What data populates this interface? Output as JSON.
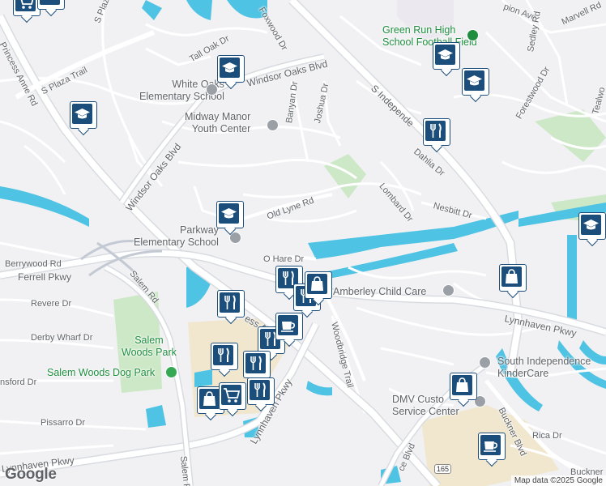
{
  "map": {
    "colors": {
      "land": "#f1f1f4",
      "road": "#ffffff",
      "road_outline": "#d8dbe0",
      "highway": "#aab4c3",
      "water": "#4fc3e3",
      "park": "#cde8c7",
      "commercial": "#f1e7cf",
      "marker": "#1b4e7a"
    },
    "streets": [
      {
        "id": "princess-anne-rd",
        "label": "Princess Anne Rd"
      },
      {
        "id": "s-plaza-trail",
        "label": "S Plaza Trail"
      },
      {
        "id": "s-plaza-top",
        "label": "S Plaza"
      },
      {
        "id": "tall-oak-dr",
        "label": "Tall Oak Dr"
      },
      {
        "id": "foxwood-dr",
        "label": "Foxwood Dr"
      },
      {
        "id": "windsor-oaks-blvd-north",
        "label": "Windsor Oaks Blvd"
      },
      {
        "id": "windsor-oaks-blvd-west",
        "label": "Windsor Oaks Blvd"
      },
      {
        "id": "banyan-dr",
        "label": "Banyan Dr"
      },
      {
        "id": "joshua-dr",
        "label": "Joshua Dr"
      },
      {
        "id": "s-independence",
        "label": "S Independe"
      },
      {
        "id": "dahlia-dr",
        "label": "Dahlia Dr"
      },
      {
        "id": "lombard-dr",
        "label": "Lombard Dr"
      },
      {
        "id": "nesbitt-dr",
        "label": "Nesbitt Dr"
      },
      {
        "id": "old-lyne-rd",
        "label": "Old Lyne Rd"
      },
      {
        "id": "ohare-dr",
        "label": "O Hare Dr"
      },
      {
        "id": "berrywood-rd",
        "label": "Berrywood Rd"
      },
      {
        "id": "ferrell-pkwy",
        "label": "Ferrell Pkwy"
      },
      {
        "id": "salem-rd",
        "label": "Salem Rd"
      },
      {
        "id": "revere-dr",
        "label": "Revere Dr"
      },
      {
        "id": "derby-wharf-dr",
        "label": "Derby Wharf Dr"
      },
      {
        "id": "princess-anne-mid",
        "label": "ess A"
      },
      {
        "id": "lynnhaven-pkwy-mid",
        "label": "Lynnhaven Pkwy"
      },
      {
        "id": "lynnhaven-pkwy-right",
        "label": "Lynnhaven Pkwy"
      },
      {
        "id": "lynnhaven-pkwy-low",
        "label": "Lynnhaven Pkwy"
      },
      {
        "id": "woodbridge-trail",
        "label": "Woodbridge Trail"
      },
      {
        "id": "ransford-dr",
        "label": "nsford Dr"
      },
      {
        "id": "pissarro-dr",
        "label": "Pissarro Dr"
      },
      {
        "id": "salem-rd-low",
        "label": "Salem R"
      },
      {
        "id": "ce-blvd",
        "label": "ce Blvd"
      },
      {
        "id": "buckner-blvd",
        "label": "Buckner Blvd"
      },
      {
        "id": "buckner-low",
        "label": "Buckner"
      },
      {
        "id": "rica-dr",
        "label": "Rica Dr"
      },
      {
        "id": "marvell-rd",
        "label": "Marvell Rd"
      },
      {
        "id": "pion-ave",
        "label": "pion Ave"
      },
      {
        "id": "sedley-rd",
        "label": "Sedley Rd"
      },
      {
        "id": "forestwood-dr",
        "label": "Forestwood Dr"
      },
      {
        "id": "tealwo",
        "label": "Tealwo"
      }
    ],
    "places": [
      {
        "id": "green-run-high",
        "label": "Green Run High\nSchool Football Field"
      },
      {
        "id": "white-oaks",
        "label": "White Oaks\nElementary School"
      },
      {
        "id": "midway-manor",
        "label": "Midway Manor\nYouth Center"
      },
      {
        "id": "parkway-elem",
        "label": "Parkway\nElementary School"
      },
      {
        "id": "amberley",
        "label": "Amberley Child Care"
      },
      {
        "id": "salem-woods-park",
        "label": "Salem\nWoods Park"
      },
      {
        "id": "salem-woods-dog",
        "label": "Salem Woods Dog Park"
      },
      {
        "id": "south-independence",
        "label": "South Independence\nKinderCare"
      },
      {
        "id": "dmv",
        "label": "DMV Custo\nService Center"
      }
    ],
    "route_shield": "165",
    "branding": "Google",
    "attribution": "Map data ©2025 Google"
  }
}
